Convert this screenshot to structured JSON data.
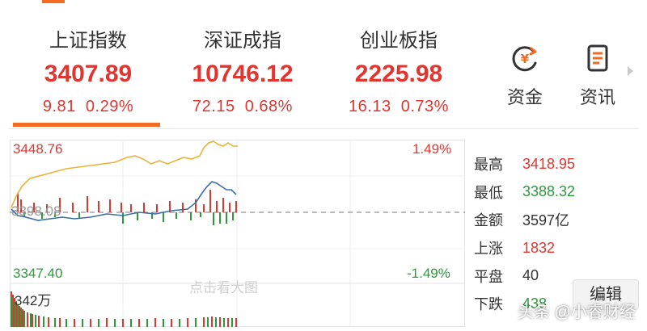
{
  "indices": [
    {
      "name": "上证指数",
      "value": "3407.89",
      "change": "9.81",
      "pct": "0.29%"
    },
    {
      "name": "深证成指",
      "value": "10746.12",
      "change": "72.15",
      "pct": "0.68%"
    },
    {
      "name": "创业板指",
      "value": "2225.98",
      "change": "16.13",
      "pct": "0.73%"
    }
  ],
  "tools": {
    "funds": "资金",
    "news": "资讯"
  },
  "chart": {
    "high_price": "3448.76",
    "low_price": "3347.40",
    "high_pct": "1.49%",
    "low_pct": "-1.49%",
    "base_price": "3398.08",
    "volume": "342万",
    "hint": "点击看大图"
  },
  "stats": [
    {
      "key": "最高",
      "value": "3418.95",
      "color": "#e2352f"
    },
    {
      "key": "最低",
      "value": "3388.32",
      "color": "#2a9a3a"
    },
    {
      "key": "金额",
      "value": "3597亿",
      "color": "#333333"
    },
    {
      "key": "上涨",
      "value": "1832",
      "color": "#e2352f"
    },
    {
      "key": "平盘",
      "value": "40",
      "color": "#333333"
    },
    {
      "key": "下跌",
      "value": "438",
      "color": "#2a9a3a"
    }
  ],
  "edit_label": "编辑",
  "watermark": "头条 @小睿财经",
  "colors": {
    "up": "#e2352f",
    "down": "#2a9a3a",
    "accent": "#f36a21"
  }
}
